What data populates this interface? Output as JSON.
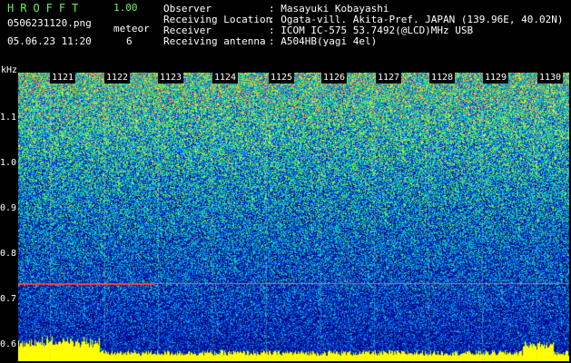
{
  "header": {
    "app_title": "HROFFT",
    "version": "1.00",
    "filename": "0506231120.png",
    "datetime": "05.06.23 11:20",
    "meteor_label": "meteor",
    "meteor_count": "6",
    "observer_label": "Observer",
    "observer_value": ": Masayuki Kobayashi",
    "location_label": "Receiving Location",
    "location_value": ": Ogata-vill. Akita-Pref. JAPAN (139.96E, 40.02N)",
    "receiver_label": "Receiver",
    "receiver_value": ": ICOM IC-575 53.7492(@LCD)MHz USB",
    "antenna_label": "Receiving antenna",
    "antenna_value": ": A504HB(yagi 4el)"
  },
  "spectrogram": {
    "y_unit": "kHz",
    "y_ticks": [
      "1.1",
      "1.0",
      "0.9",
      "0.8",
      "0.7",
      "0.6"
    ],
    "x_ticks": [
      "1121",
      "1122",
      "1123",
      "1124",
      "1125",
      "1126",
      "1127",
      "1128",
      "1129",
      "1130"
    ],
    "colors": {
      "high": "#ff3333",
      "mid": "#33ff66",
      "low": "#0018c0",
      "baseline": "#ffff00"
    }
  }
}
